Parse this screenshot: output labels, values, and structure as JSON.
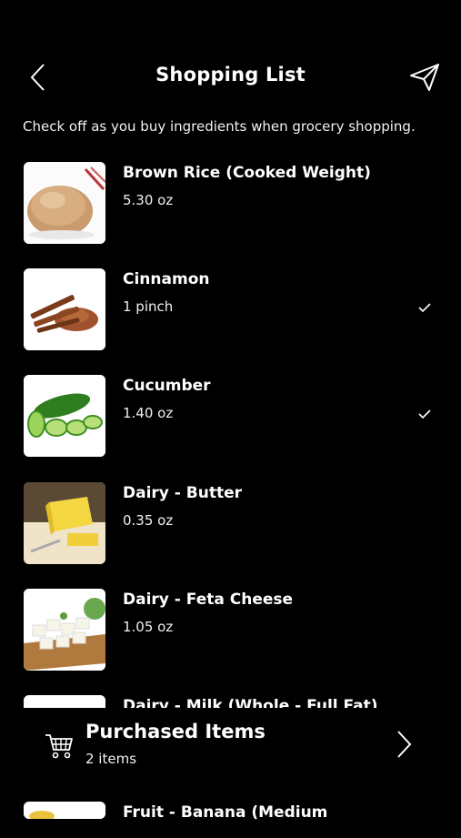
{
  "header": {
    "title": "Shopping List",
    "back_icon": "chevron-left-icon",
    "send_icon": "paper-plane-icon"
  },
  "subtitle": "Check off as you buy ingredients when grocery shopping.",
  "items": [
    {
      "name": "Brown Rice (Cooked Weight)",
      "qty": "5.30 oz",
      "checked": false,
      "icon": "brown-rice-image"
    },
    {
      "name": "Cinnamon",
      "qty": "1 pinch",
      "checked": true,
      "icon": "cinnamon-image"
    },
    {
      "name": "Cucumber",
      "qty": "1.40 oz",
      "checked": true,
      "icon": "cucumber-image"
    },
    {
      "name": "Dairy - Butter",
      "qty": "0.35 oz",
      "checked": false,
      "icon": "butter-image"
    },
    {
      "name": "Dairy - Feta Cheese",
      "qty": "1.05 oz",
      "checked": false,
      "icon": "feta-image"
    },
    {
      "name": "Dairy - Milk (Whole - Full Fat)"
    },
    {
      "name": "Fruit - Banana (Medium"
    }
  ],
  "purchased": {
    "title": "Purchased Items",
    "count": "2 items",
    "cart_icon": "cart-icon",
    "chevron_icon": "chevron-right-icon"
  }
}
